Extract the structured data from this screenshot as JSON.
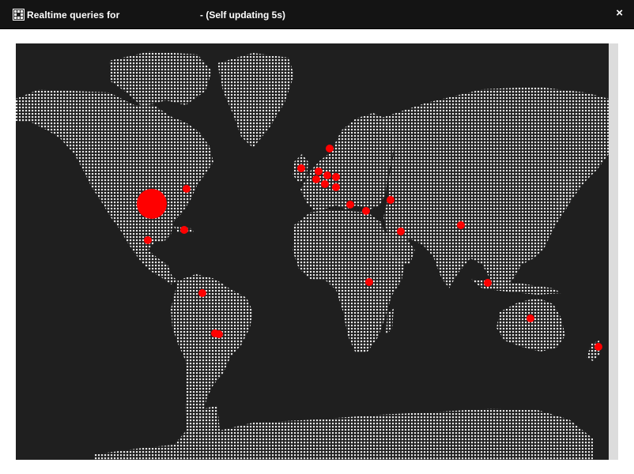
{
  "window": {
    "title_prefix": "Realtime queries for",
    "title_suffix": "- (Self updating 5s)",
    "close_glyph": "×",
    "icon": "grid-app-icon"
  },
  "map": {
    "background_color": "#1f1f1f",
    "land_color": "#e6e6e6",
    "marker_color": "#ff0000",
    "markers": [
      {
        "region": "north-america-central",
        "size": "large"
      },
      {
        "region": "north-america-east",
        "size": "small"
      },
      {
        "region": "caribbean",
        "size": "small"
      },
      {
        "region": "mexico",
        "size": "small"
      },
      {
        "region": "south-america-bolivia",
        "size": "small"
      },
      {
        "region": "south-america-argentina",
        "size": "small"
      },
      {
        "region": "south-america-argentina-2",
        "size": "small"
      },
      {
        "region": "scandinavia",
        "size": "small"
      },
      {
        "region": "uk",
        "size": "small"
      },
      {
        "region": "netherlands",
        "size": "small"
      },
      {
        "region": "germany",
        "size": "small"
      },
      {
        "region": "poland",
        "size": "small"
      },
      {
        "region": "france",
        "size": "small"
      },
      {
        "region": "switzerland",
        "size": "small"
      },
      {
        "region": "hungary",
        "size": "small"
      },
      {
        "region": "tunisia",
        "size": "small"
      },
      {
        "region": "greece",
        "size": "small"
      },
      {
        "region": "iran",
        "size": "small"
      },
      {
        "region": "gulf",
        "size": "small"
      },
      {
        "region": "india",
        "size": "small"
      },
      {
        "region": "east-africa",
        "size": "small"
      },
      {
        "region": "indonesia",
        "size": "small"
      },
      {
        "region": "australia",
        "size": "small"
      },
      {
        "region": "new-zealand",
        "size": "small"
      }
    ]
  }
}
